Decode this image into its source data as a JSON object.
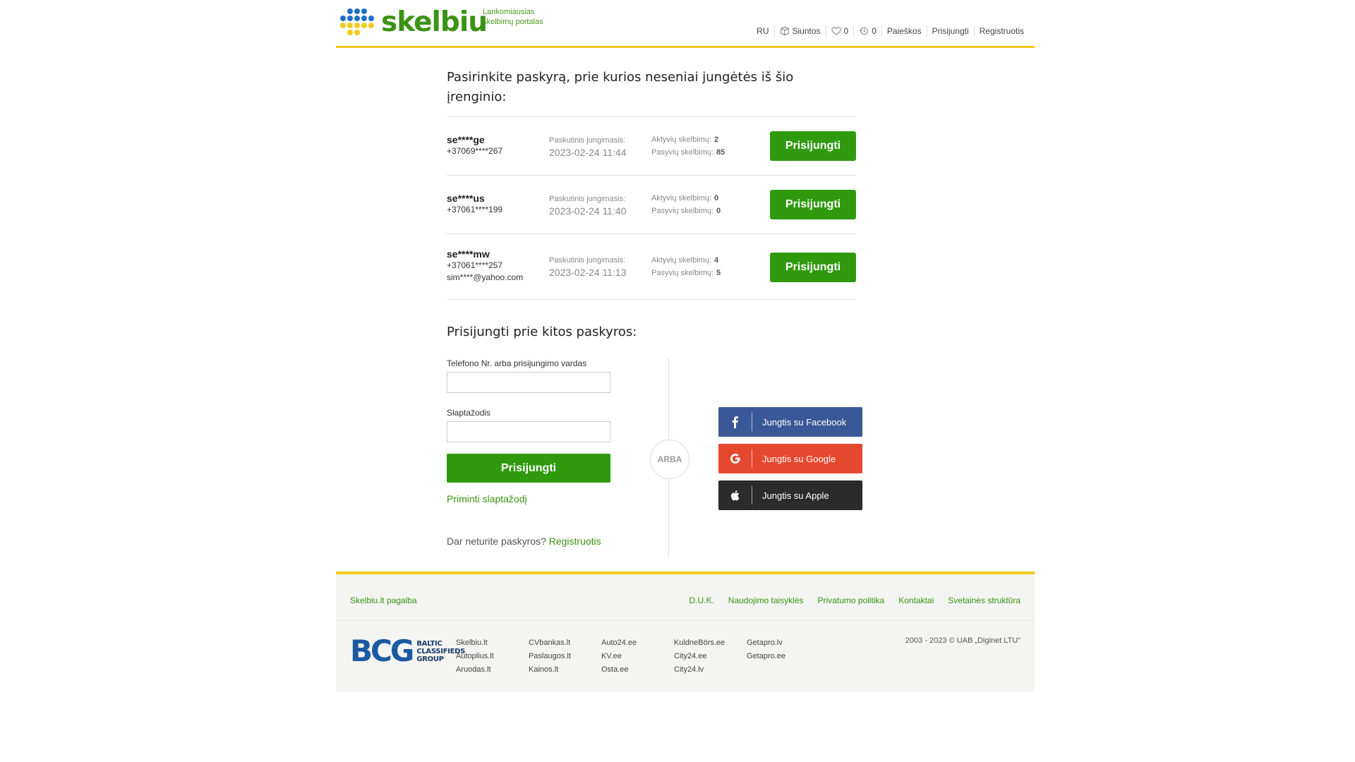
{
  "header": {
    "logo_text": "skelbiu",
    "tagline_line1": "Lankomiausias",
    "tagline_line2": "skelbimų portalas",
    "nav": {
      "lang": "RU",
      "shipments": "Siuntos",
      "favorites_count": "0",
      "history_count": "0",
      "searches": "Paieškos",
      "login": "Prisijungti",
      "register": "Registruotis"
    },
    "colors": {
      "brand_green": "#3a9314",
      "accent_yellow": "#f2cb1d",
      "logo_blue": "#1f6fc5"
    }
  },
  "recent": {
    "title": "Pasirinkite paskyrą, prie kurios neseniai jungėtės iš šio įrenginio:",
    "last_login_label": "Paskutinis jungimasis:",
    "active_label": "Aktyvių skelbimų:",
    "passive_label": "Pasyvių skelbimų:",
    "button_label": "Prisijungti",
    "accounts": [
      {
        "name": "se****ge",
        "phone": "+37069****267",
        "email": "",
        "last_login": "2023-02-24 11:44",
        "active": "2",
        "passive": "85"
      },
      {
        "name": "se****us",
        "phone": "+37061****199",
        "email": "",
        "last_login": "2023-02-24 11:40",
        "active": "0",
        "passive": "0"
      },
      {
        "name": "se****mw",
        "phone": "+37061****257",
        "email": "sim****@yahoo.com",
        "last_login": "2023-02-24 11:13",
        "active": "4",
        "passive": "5"
      }
    ]
  },
  "login": {
    "title": "Prisijungti prie kitos paskyros:",
    "username_label": "Telefono Nr. arba prisijungimo vardas",
    "username_value": "",
    "password_label": "Slaptažodis",
    "password_value": "",
    "submit_label": "Prisijungti",
    "remind_label": "Priminti slaptažodį",
    "no_account_text": "Dar neturite paskyros?",
    "register_link": "Registruotis",
    "or_label": "ARBA",
    "facebook_label": "Jungtis su Facebook",
    "google_label": "Jungtis su Google",
    "apple_label": "Jungtis su Apple"
  },
  "footer": {
    "help": "Skelbiu.lt pagalba",
    "links": [
      "D.U.K.",
      "Naudojimo taisyklės",
      "Privatumo politika",
      "Kontaktai",
      "Svetainės struktūra"
    ],
    "bcg_mark": "BCG",
    "bcg_line1": "BALTIC",
    "bcg_line2": "CLASSIFIEDS",
    "bcg_line3": "GROUP",
    "site_columns": [
      [
        "Skelbiu.lt",
        "Autoplius.lt",
        "Aruodas.lt"
      ],
      [
        "CVbankas.lt",
        "Paslaugos.lt",
        "Kainos.lt"
      ],
      [
        "Auto24.ee",
        "KV.ee",
        "Osta.ee"
      ],
      [
        "KuldneBörs.ee",
        "City24.ee",
        "City24.lv"
      ],
      [
        "Getapro.lv",
        "Getapro.ee"
      ]
    ],
    "copyright": "2003 - 2023 © UAB „Diginet LTU“"
  }
}
